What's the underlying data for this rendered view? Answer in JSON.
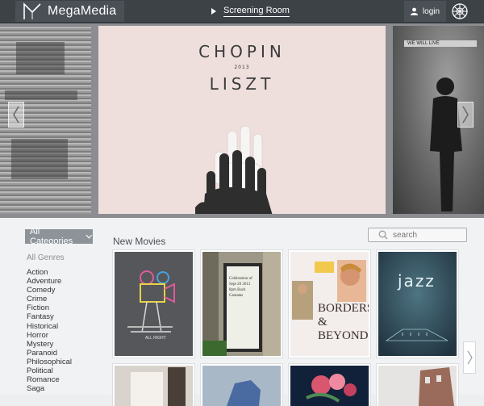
{
  "header": {
    "brand_name": "MegaMedia",
    "nav_label": "Screening Room",
    "login_label": "login",
    "icons": {
      "logo": "megamedia-logo-icon",
      "play": "play-icon",
      "user": "user-icon",
      "globe": "globe-icon"
    }
  },
  "carousel": {
    "featured": {
      "title_line1": "CHOPIN",
      "mid_text": "2013",
      "title_line2": "LISZT"
    },
    "left_slide_text": "",
    "right_slide_text": "WE WILL LIVE",
    "icons": {
      "prev": "chevron-left-icon",
      "next": "chevron-right-icon"
    }
  },
  "filters": {
    "category_label": "All Categories",
    "all_genres_label": "All Genres",
    "genres": [
      "Action",
      "Adventure",
      "Comedy",
      "Crime",
      "Fiction",
      "Fantasy",
      "Historical",
      "Horror",
      "Mystery",
      "Paranoid",
      "Philosophical",
      "Political",
      "Romance",
      "Saga"
    ]
  },
  "main": {
    "section_title": "New Movies",
    "search_placeholder": "search",
    "movies": [
      {
        "poster_text": "ALL RIGHT"
      },
      {
        "poster_text": "Celebration of Sept 20 2013 8pm Bach Cantatas"
      },
      {
        "poster_text": "BORDERS & BEYOND"
      },
      {
        "poster_text": "jazz"
      }
    ]
  },
  "colors": {
    "topbar": "#3d4247",
    "accent_button": "#8d9399",
    "page_bg": "#f1f2f3"
  }
}
